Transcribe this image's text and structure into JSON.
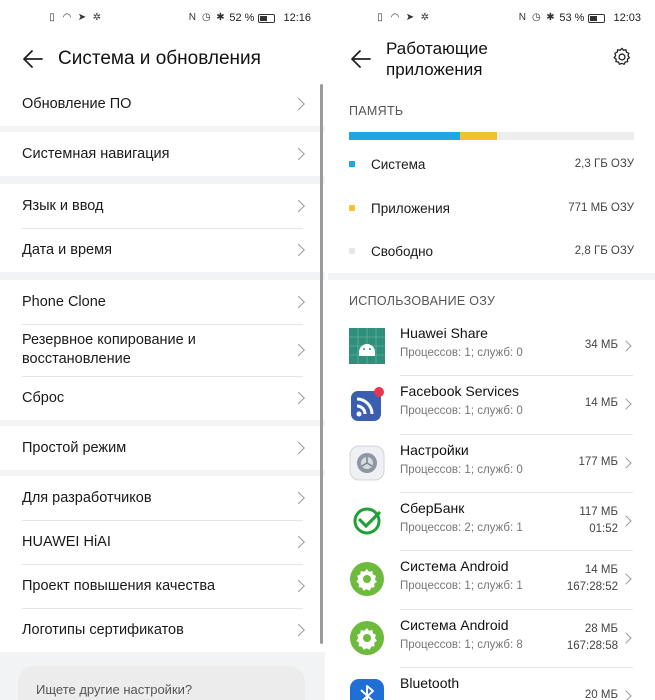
{
  "left": {
    "status": {
      "battery": "52 %",
      "time": "12:16"
    },
    "title": "Система и обновления",
    "groups": [
      [
        "Обновление ПО"
      ],
      [
        "Системная навигация"
      ],
      [
        "Язык и ввод",
        "Дата и время"
      ],
      [
        "Phone Clone",
        "Резервное копирование и восстановление",
        "Сброс"
      ],
      [
        "Простой режим"
      ],
      [
        "Для разработчиков",
        "HUAWEI HiAI",
        "Проект повышения качества",
        "Логотипы сертификатов"
      ]
    ],
    "search_hint": "Ищете другие настройки?"
  },
  "right": {
    "status": {
      "battery": "53 %",
      "time": "12:03"
    },
    "title_line1": "Работающие",
    "title_line2": "приложения",
    "memory": {
      "label": "ПАМЯТЬ",
      "bar": [
        {
          "fraction": 0.39,
          "color": "#1ea7e0"
        },
        {
          "fraction": 0.13,
          "color": "#f2c12e"
        }
      ],
      "rows": [
        {
          "label": "Система",
          "value": "2,3 ГБ ОЗУ",
          "color": "#1ea7e0"
        },
        {
          "label": "Приложения",
          "value": "771 МБ ОЗУ",
          "color": "#f2c12e"
        },
        {
          "label": "Свободно",
          "value": "2,8 ГБ ОЗУ",
          "color": "#e6e6e6"
        }
      ]
    },
    "usage_label": "ИСПОЛЬЗОВАНИЕ ОЗУ",
    "apps": [
      {
        "name": "Huawei Share",
        "sub": "Процессов: 1; служб: 0",
        "size": "34 МБ",
        "time": "",
        "icon": "huawei-share-icon"
      },
      {
        "name": "Facebook Services",
        "sub": "Процессов: 1; служб: 0",
        "size": "14 МБ",
        "time": "",
        "icon": "facebook-services-icon"
      },
      {
        "name": "Настройки",
        "sub": "Процессов: 1; служб: 0",
        "size": "177 МБ",
        "time": "",
        "icon": "settings-app-icon"
      },
      {
        "name": "СберБанк",
        "sub": "Процессов: 2; служб: 1",
        "size": "117 МБ",
        "time": "01:52",
        "icon": "sberbank-icon"
      },
      {
        "name": "Система Android",
        "sub": "Процессов: 1; служб: 1",
        "size": "14 МБ",
        "time": "167:28:52",
        "icon": "android-system-icon"
      },
      {
        "name": "Система Android",
        "sub": "Процессов: 1; служб: 8",
        "size": "28 МБ",
        "time": "167:28:58",
        "icon": "android-system-icon"
      },
      {
        "name": "Bluetooth",
        "sub": "",
        "size": "20 МБ",
        "time": "",
        "icon": "bluetooth-icon"
      }
    ]
  }
}
